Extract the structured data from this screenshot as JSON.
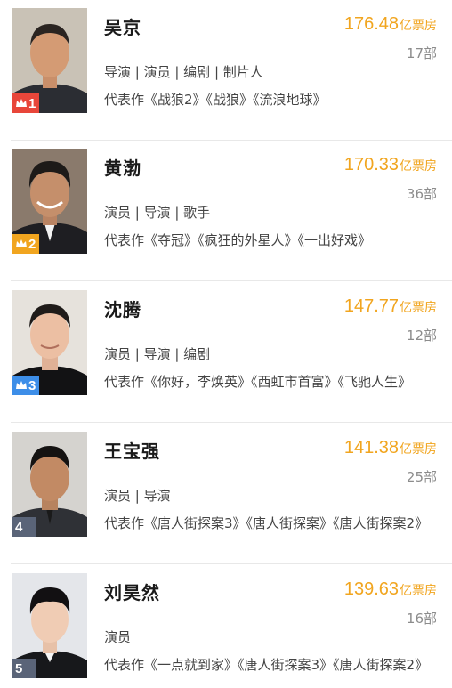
{
  "ranking": [
    {
      "rank": "1",
      "name": "吴京",
      "box_office": "176.48",
      "box_office_unit": "亿票房",
      "film_count": "17部",
      "roles": "导演 | 演员 | 编剧 | 制片人",
      "works": "代表作《战狼2》《战狼》《流浪地球》",
      "badge_color": "#e8463a",
      "badge_icon": "crown-icon"
    },
    {
      "rank": "2",
      "name": "黄渤",
      "box_office": "170.33",
      "box_office_unit": "亿票房",
      "film_count": "36部",
      "roles": "演员 | 导演 | 歌手",
      "works": "代表作《夺冠》《疯狂的外星人》《一出好戏》",
      "badge_color": "#f1a51f",
      "badge_icon": "crown-icon"
    },
    {
      "rank": "3",
      "name": "沈腾",
      "box_office": "147.77",
      "box_office_unit": "亿票房",
      "film_count": "12部",
      "roles": "演员 | 导演 | 编剧",
      "works": "代表作《你好，李焕英》《西虹市首富》《飞驰人生》",
      "badge_color": "#3d8ee8",
      "badge_icon": "crown-icon"
    },
    {
      "rank": "4",
      "name": "王宝强",
      "box_office": "141.38",
      "box_office_unit": "亿票房",
      "film_count": "25部",
      "roles": "演员 | 导演",
      "works": "代表作《唐人街探案3》《唐人街探案》《唐人街探案2》",
      "badge_color": "#5a6478",
      "badge_icon": ""
    },
    {
      "rank": "5",
      "name": "刘昊然",
      "box_office": "139.63",
      "box_office_unit": "亿票房",
      "film_count": "16部",
      "roles": "演员",
      "works": "代表作《一点就到家》《唐人街探案3》《唐人街探案2》",
      "badge_color": "#5a6478",
      "badge_icon": ""
    }
  ]
}
